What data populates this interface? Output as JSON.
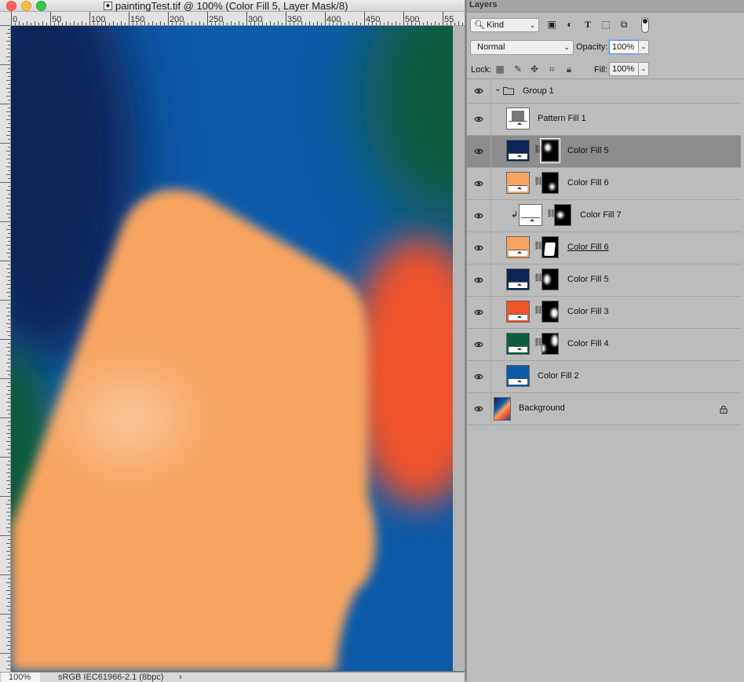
{
  "document": {
    "title": "paintingTest.tif @ 100% (Color Fill 5, Layer Mask/8)",
    "ruler_labels": [
      "0",
      "50",
      "100",
      "150",
      "200",
      "250",
      "300",
      "350",
      "400",
      "450",
      "500",
      "55"
    ],
    "zoom": "100%",
    "color_profile": "sRGB IEC61966-2.1 (8bpc)",
    "status_arrow": "›"
  },
  "colors": {
    "navy": "#0b2356",
    "blue": "#0d5aa8",
    "green": "#0b5c3c",
    "orange": "#f0532a",
    "peach": "#f7a461",
    "selected_row": "#8c8c8c"
  },
  "panel": {
    "tab": "Layers",
    "filter_kind": "Kind",
    "filter_icons": [
      "image-filter-icon",
      "adjustment-filter-icon",
      "type-filter-icon",
      "shape-filter-icon",
      "smart-object-filter-icon",
      "filter-toggle-icon"
    ],
    "blend_mode": "Normal",
    "opacity_label": "Opacity:",
    "opacity_value": "100%",
    "lock_label": "Lock:",
    "lock_icons": [
      "lock-transparent-icon",
      "lock-image-icon",
      "lock-position-icon",
      "lock-artboard-icon",
      "lock-all-icon"
    ],
    "fill_label": "Fill:",
    "fill_value": "100%"
  },
  "layers": [
    {
      "name": "Group 1",
      "type": "group"
    },
    {
      "name": "Pattern Fill 1",
      "type": "fill",
      "color": "#7a7a7a"
    },
    {
      "name": "Color Fill 5",
      "type": "fill_mask",
      "color": "#0b2356",
      "selected": true
    },
    {
      "name": "Color Fill 6",
      "type": "fill_mask",
      "color": "#f7a461"
    },
    {
      "name": "Color Fill 7",
      "type": "fill_mask_clipped",
      "color": "#ffffff"
    },
    {
      "name": "Color Fill 6",
      "type": "fill_mask",
      "color": "#f7a461",
      "underlined": true
    },
    {
      "name": "Color Fill 5",
      "type": "fill_mask",
      "color": "#0b2356"
    },
    {
      "name": "Color Fill 3",
      "type": "fill_mask",
      "color": "#f0532a"
    },
    {
      "name": "Color Fill 4",
      "type": "fill_mask",
      "color": "#0b5c3c"
    },
    {
      "name": "Color Fill 2",
      "type": "fill",
      "color": "#0d5aa8"
    },
    {
      "name": "Background",
      "type": "background",
      "locked": true
    }
  ]
}
